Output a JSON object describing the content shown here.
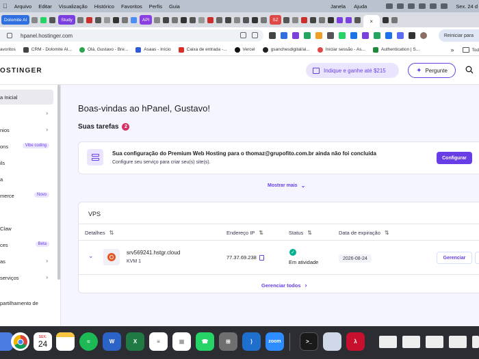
{
  "menubar": {
    "items": [
      "Arquivo",
      "Editar",
      "Visualização",
      "Histórico",
      "Favoritos",
      "Perfis",
      "Guia"
    ],
    "right_items": [
      "Janela",
      "Ajuda"
    ],
    "clock": "Sex. 24 d"
  },
  "tabs": {
    "chips": [
      {
        "label": "Dolomite AI",
        "color": "#2f6fdf"
      },
      {
        "label": "Study",
        "color": "#7b3fe0"
      },
      {
        "label": "API",
        "color": "#8a3fe0"
      },
      {
        "label": "SZ",
        "color": "#e04848"
      }
    ],
    "active_close": "×"
  },
  "address": {
    "url": "hpanel.hostinger.com",
    "reiniciar": "Reiniciar para"
  },
  "bookmarks": [
    {
      "label": "avoritos",
      "color": "#888"
    },
    {
      "label": "CRM - Dolomite AI...",
      "color": "#444"
    },
    {
      "label": "Olá, Gustavo - Bre...",
      "color": "#2da44e"
    },
    {
      "label": "Asaas - Início",
      "color": "#2f5bd6"
    },
    {
      "label": "Caixa de entrada -...",
      "color": "#d93025"
    },
    {
      "label": "Vercel",
      "color": "#111"
    },
    {
      "label": "gsanchesdigital/ai...",
      "color": "#222"
    },
    {
      "label": "Iniciar sessão - As...",
      "color": "#e04848"
    },
    {
      "label": "Authentication | S...",
      "color": "#1f8a3a"
    }
  ],
  "bookmarks_overflow": "»",
  "bookmarks_folder": "Tod",
  "header": {
    "logo": "OSTINGER",
    "referral": "Indique e ganhe até $215",
    "ask": "Pergunte"
  },
  "sidebar": {
    "items": [
      {
        "label": "a Inicial",
        "active": true,
        "chevron": "",
        "badge": ""
      },
      {
        "label": "",
        "active": false,
        "chevron": "›",
        "badge": ""
      },
      {
        "label": "nios",
        "active": false,
        "chevron": "›",
        "badge": ""
      },
      {
        "label": "ons",
        "active": false,
        "chevron": "",
        "badge": "Vibe coding"
      },
      {
        "label": "ils",
        "active": false,
        "chevron": "",
        "badge": ""
      },
      {
        "label": "a",
        "active": false,
        "chevron": "",
        "badge": ""
      },
      {
        "label": "merce",
        "active": false,
        "chevron": "",
        "badge": "Novo"
      },
      {
        "label": "",
        "active": false,
        "chevron": "",
        "badge": ""
      },
      {
        "label": "Claw",
        "active": false,
        "chevron": "",
        "badge": ""
      },
      {
        "label": "ces",
        "active": false,
        "chevron": "",
        "badge": "Beta"
      },
      {
        "label": "as",
        "active": false,
        "chevron": "›",
        "badge": ""
      },
      {
        "label": "serviços",
        "active": false,
        "chevron": "›",
        "badge": ""
      },
      {
        "label": "partilhamento de",
        "active": false,
        "chevron": "",
        "badge": ""
      }
    ]
  },
  "main": {
    "welcome": "Boas-vindas ao hPanel, Gustavo!",
    "tasks_title": "Suas tarefas",
    "tasks_count": "2",
    "task": {
      "title": "Sua configuração do Premium Web Hosting para o thomaz@grupofito.com.br ainda não foi concluída",
      "subtitle": "Configure seu serviço para criar seu(s) site(s).",
      "button": "Configurar"
    },
    "show_more": "Mostrar mais",
    "vps": {
      "title": "VPS",
      "columns": [
        "Detalhes",
        "Endereço IP",
        "Status",
        "Data de expiração"
      ],
      "row": {
        "hostname": "srv569241.hstgr.cloud",
        "plan": "KVM 1",
        "ip": "77.37.69.238",
        "status": "Em atividade",
        "expiry": "2026-08-24",
        "manage": "Gerenciar"
      },
      "manage_all": "Gerenciar todos"
    }
  },
  "dock": {
    "calendar_month": "SEX.",
    "calendar_day": "24",
    "zoom_label": "zoom"
  },
  "colors": {
    "accent": "#673de6",
    "success": "#00b090",
    "badge_red": "#d63163"
  }
}
